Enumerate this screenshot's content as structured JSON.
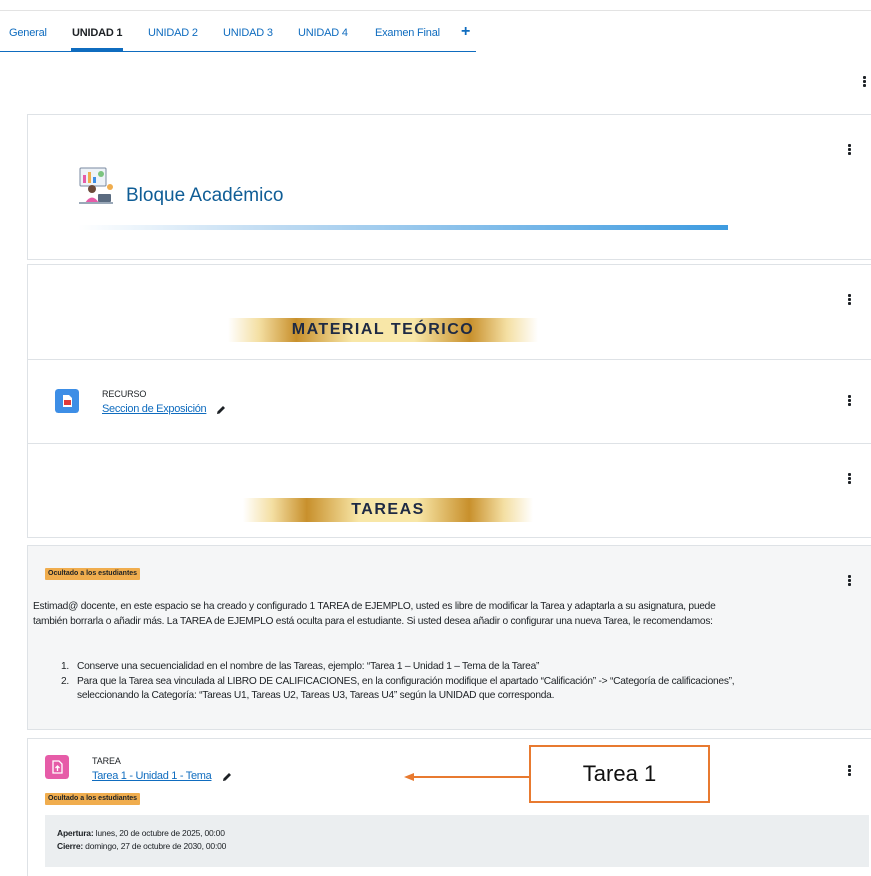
{
  "tabs": [
    {
      "label": "General"
    },
    {
      "label": "UNIDAD 1",
      "active": true
    },
    {
      "label": "UNIDAD 2"
    },
    {
      "label": "UNIDAD 3"
    },
    {
      "label": "UNIDAD 4"
    },
    {
      "label": "Examen Final"
    }
  ],
  "tab_add_icon": "plus-icon",
  "bloque": {
    "title": "Bloque Académico",
    "icon": "teacher-illustration-icon"
  },
  "material": {
    "banner": "MATERIAL TEÓRICO"
  },
  "recurso": {
    "type": "RECURSO",
    "title": "Seccion de Exposición",
    "icon": "pdf-file-icon",
    "icon_color": "#3d8ee6"
  },
  "tareas": {
    "banner": "TAREAS"
  },
  "note": {
    "badge": "Ocultado a los estudiantes",
    "paragraph": "Estimad@ docente, en este espacio se ha creado y configurado 1 TAREA de EJEMPLO, usted es libre de modificar la Tarea y adaptarla a su asignatura, puede también borrarla o añadir más. La TAREA de EJEMPLO está oculta para el estudiante. Si usted desea añadir o configurar una nueva Tarea, le recomendamos:",
    "items": [
      {
        "num": "1.",
        "text": "Conserve una secuencialidad en el nombre de las Tareas, ejemplo: “Tarea 1 – Unidad 1 – Tema de la Tarea”"
      },
      {
        "num": "2.",
        "text": "Para que la Tarea sea vinculada al LIBRO DE CALIFICACIONES, en la configuración modifique el apartado “Calificación” -> “Categoría de calificaciones”, seleccionando la Categoría: “Tareas U1, Tareas U2, Tareas U3, Tareas U4” según la UNIDAD que corresponda."
      }
    ]
  },
  "tarea": {
    "type": "TAREA",
    "title": "Tarea 1 - Unidad 1 - Tema",
    "badge": "Ocultado a los estudiantes",
    "icon": "assignment-upload-icon",
    "icon_color": "#e65ca8",
    "apertura_label": "Apertura:",
    "apertura_value": " lunes, 20 de octubre de 2025, 00:00",
    "cierre_label": "Cierre:",
    "cierre_value": " domingo, 27 de octubre de 2030, 00:00"
  },
  "annotation": {
    "label": "Tarea 1",
    "color": "#e87a30"
  },
  "colors": {
    "link": "#0f6cbf",
    "badge": "#f0ad4e",
    "gold": "#c8902c"
  }
}
